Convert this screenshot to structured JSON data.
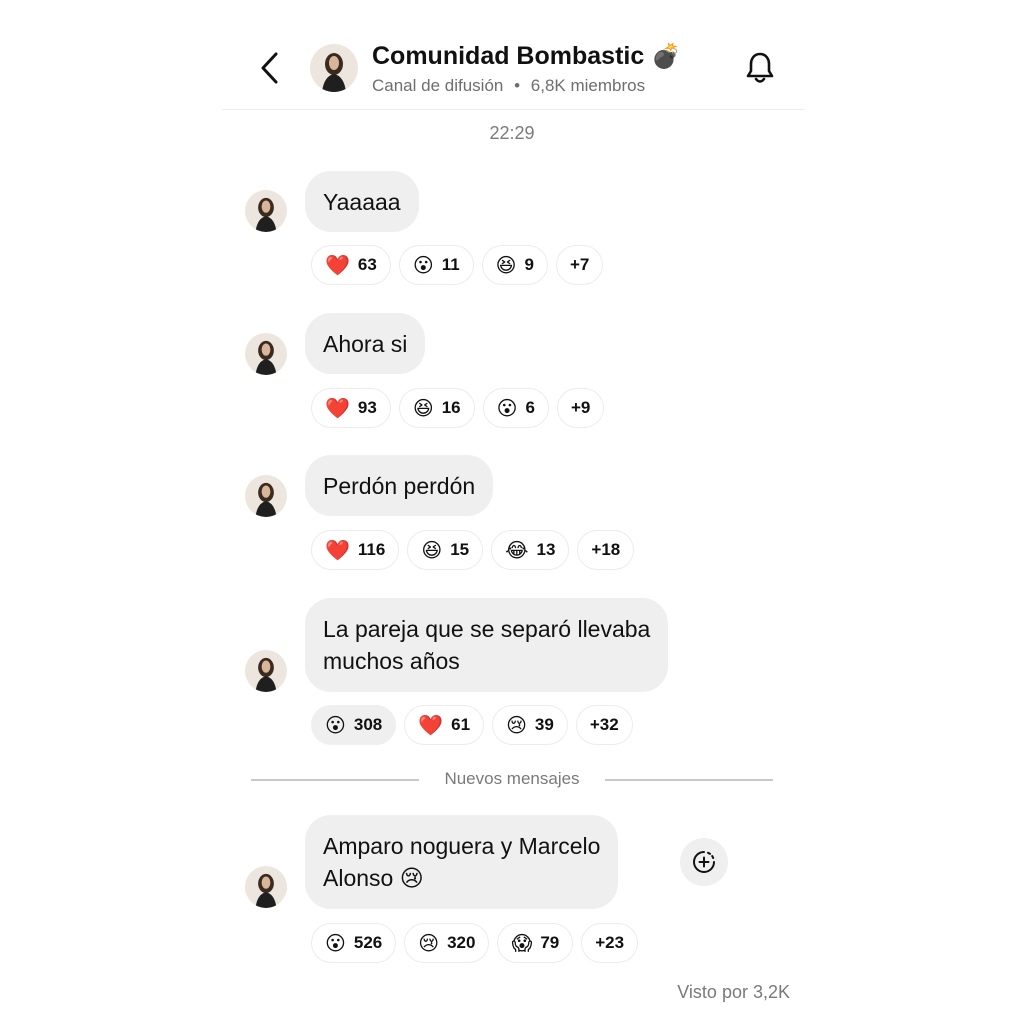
{
  "header": {
    "title": "Comunidad Bombastic",
    "title_emoji": "💣",
    "subtitle_type": "Canal de difusión",
    "subtitle_separator": "•",
    "subtitle_members": "6,8K miembros",
    "back_icon": "chevron-left-icon",
    "bell_icon": "bell-icon"
  },
  "timestamp": "22:29",
  "messages": [
    {
      "text": "Yaaaaa",
      "reactions": [
        {
          "emoji": "❤️",
          "count": "63"
        },
        {
          "emoji": "😮",
          "count": "11"
        },
        {
          "emoji": "😆",
          "count": "9"
        },
        {
          "emoji": "",
          "count": "+7"
        }
      ]
    },
    {
      "text": "Ahora si",
      "reactions": [
        {
          "emoji": "❤️",
          "count": "93"
        },
        {
          "emoji": "😆",
          "count": "16"
        },
        {
          "emoji": "😮",
          "count": "6"
        },
        {
          "emoji": "",
          "count": "+9"
        }
      ]
    },
    {
      "text": "Perdón perdón",
      "reactions": [
        {
          "emoji": "❤️",
          "count": "116"
        },
        {
          "emoji": "😆",
          "count": "15"
        },
        {
          "emoji": "😂",
          "count": "13"
        },
        {
          "emoji": "",
          "count": "+18"
        }
      ]
    },
    {
      "text_line1": "La pareja que se separó llevaba",
      "text_line2": "muchos años",
      "reactions": [
        {
          "emoji": "😮",
          "count": "308"
        },
        {
          "emoji": "❤️",
          "count": "61"
        },
        {
          "emoji": "😢",
          "count": "39"
        },
        {
          "emoji": "",
          "count": "+32"
        }
      ]
    },
    {
      "text_line1": "Amparo noguera y Marcelo",
      "text_line2": "Alonso 😢",
      "reactions": [
        {
          "emoji": "😮",
          "count": "526"
        },
        {
          "emoji": "😢",
          "count": "320"
        },
        {
          "emoji": "😱",
          "count": "79"
        },
        {
          "emoji": "",
          "count": "+23"
        }
      ]
    }
  ],
  "new_messages_label": "Nuevos mensajes",
  "seen_label": "Visto por 3,2K",
  "colors": {
    "bubble": "#efefef",
    "muted_text": "#7a7a7a",
    "heart": "#e0245e"
  }
}
